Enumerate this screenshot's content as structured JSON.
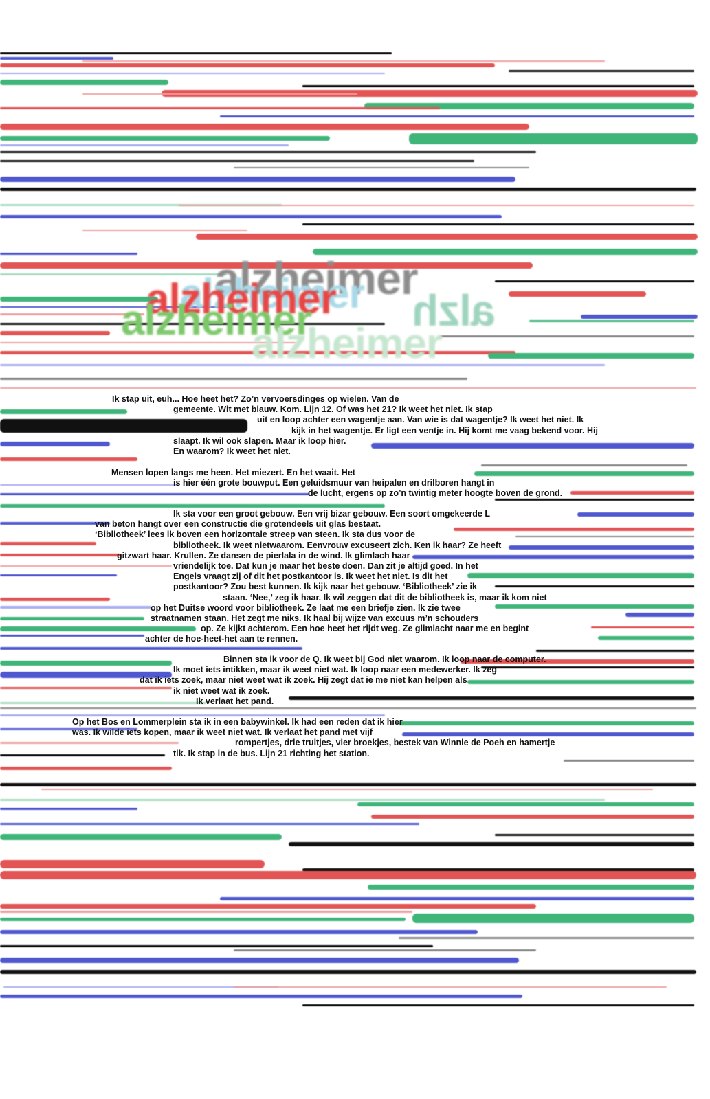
{
  "colors": {
    "red": "#e35555",
    "green": "#3fb57a",
    "blue": "#5058d0",
    "black": "#111111",
    "gray": "#8a8a8a",
    "pink": "#f2a0a0",
    "lightblue": "#a8aef0",
    "lightgreen": "#a9dcc0",
    "title_gray": "#8c8c8c",
    "title_red": "#e64646",
    "title_green": "#7dc86a",
    "title_lightblue": "#a9d9e8",
    "title_teal": "#9fd4bf",
    "title_lightgreen": "#c7e6cf"
  },
  "title": {
    "word": "alzheimer",
    "mirrored_fragment": "alzh"
  },
  "story": {
    "p1": [
      "Ik stap uit, euh... Hoe heet het? Zo’n vervoersdinges op wielen. Van de",
      "gemeente. Wit met blauw. Kom. Lijn 12. Of was het 21? Ik weet het niet. Ik stap",
      "uit en loop achter een wagentje aan. Van wie is dat wagentje? Ik weet het niet. Ik",
      "kijk in het wagentje. Er ligt een ventje in. Hij komt me vaag bekend voor. Hij",
      "slaapt. Ik wil ook slapen. Maar ik loop hier.",
      "En waarom? Ik weet het niet."
    ],
    "p2": [
      "Mensen lopen langs me heen. Het miezert. En het waait. Het",
      "is hier één grote bouwput. Een geluidsmuur van heipalen en drilboren hangt in",
      "de lucht, ergens op zo’n twintig meter hoogte boven de grond."
    ],
    "p3": [
      "Ik sta voor een groot gebouw. Een vrij bizar gebouw. Een soort omgekeerde L",
      "van beton hangt over een constructie die grotendeels uit glas bestaat.",
      "‘Bibliotheek’ lees ik boven een horizontale streep van steen. Ik sta dus voor de",
      "bibliotheek. Ik weet nietwaarom. Eenvrouw excuseert zich. Ken ik haar? Ze heeft",
      "gitzwart haar. Krullen. Ze dansen de pierlala in de wind. Ik glimlach haar",
      "vriendelijk toe. Dat kun je maar het beste doen. Dan zit je altijd goed. In het",
      "Engels vraagt zij of dit het postkantoor is. Ik weet het niet. Is dit het",
      "postkantoor? Zou best kunnen. Ik kijk naar het gebouw. ‘Bibliotheek’ zie ik",
      "staan. ‘Nee,’ zeg ik haar. Ik wil zeggen dat dit de bibliotheek is, maar ik kom niet",
      "op het Duitse woord voor bibliotheek. Ze laat me een briefje zien. Ik zie twee",
      "straatnamen staan. Het zegt me niks. Ik haal bij wijze van excuus m’n schouders",
      "op. Ze kijkt achterom. Een hoe heet het rijdt weg. Ze glimlacht naar me en begint",
      "achter de hoe-heet-het aan te rennen."
    ],
    "p4": [
      "Binnen sta ik voor de Q. Ik weet bij God niet waarom. Ik loop naar de computer.",
      "Ik moet iets intikken, maar ik weet niet wat. Ik loop naar een medewerker. Ik zeg",
      "dat ik iets zoek, maar niet weet wat ik zoek. Hij zegt dat ie me niet kan helpen als",
      "ik niet weet wat ik zoek.",
      "Ik verlaat het pand."
    ],
    "p5": [
      "Op het Bos en Lommerplein sta ik in een babywinkel. Ik had een reden dat ik hier",
      "was. Ik wilde iets kopen, maar ik weet niet wat. Ik verlaat het pand met vijf",
      "rompertjes, drie truitjes, vier broekjes, bestek van Winnie de Poeh en hamertje",
      "tik. Ik stap in de bus. Lijn 21 richting het station."
    ]
  }
}
